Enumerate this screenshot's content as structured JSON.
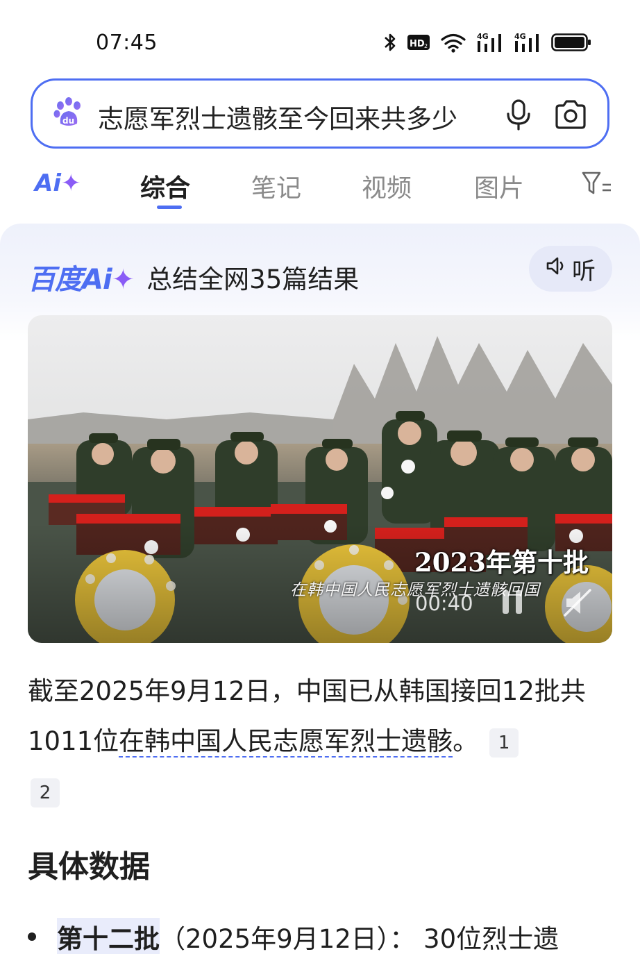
{
  "status_bar": {
    "time": "07:45"
  },
  "search": {
    "query": "志愿军烈士遗骸至今回来共多少"
  },
  "tabs": {
    "ai_label": "Ai",
    "items": [
      "综合",
      "笔记",
      "视频",
      "图片"
    ],
    "active": "综合"
  },
  "ai_card": {
    "brand": "百度Ai",
    "summary": "总结全网35篇结果",
    "listen_label": "听"
  },
  "video": {
    "caption": "2023年第十批",
    "subtitle": "在韩中国人民志愿军烈士遗骸回国",
    "time": "00:40"
  },
  "answer": {
    "part1": "截至2025年9月12日，中国已从韩国接回12批共1011位",
    "underlined": "在韩中国人民志愿军烈士遗骸",
    "part2": "。",
    "citations": [
      "1",
      "2"
    ]
  },
  "section": {
    "title": "具体数据"
  },
  "bullets": [
    {
      "highlight": "第十二批",
      "text": "（2025年9月12日）： 30位烈士遗"
    }
  ],
  "colors": {
    "accent": "#4e6ef2",
    "ai_purple": "#8a5cf6"
  }
}
